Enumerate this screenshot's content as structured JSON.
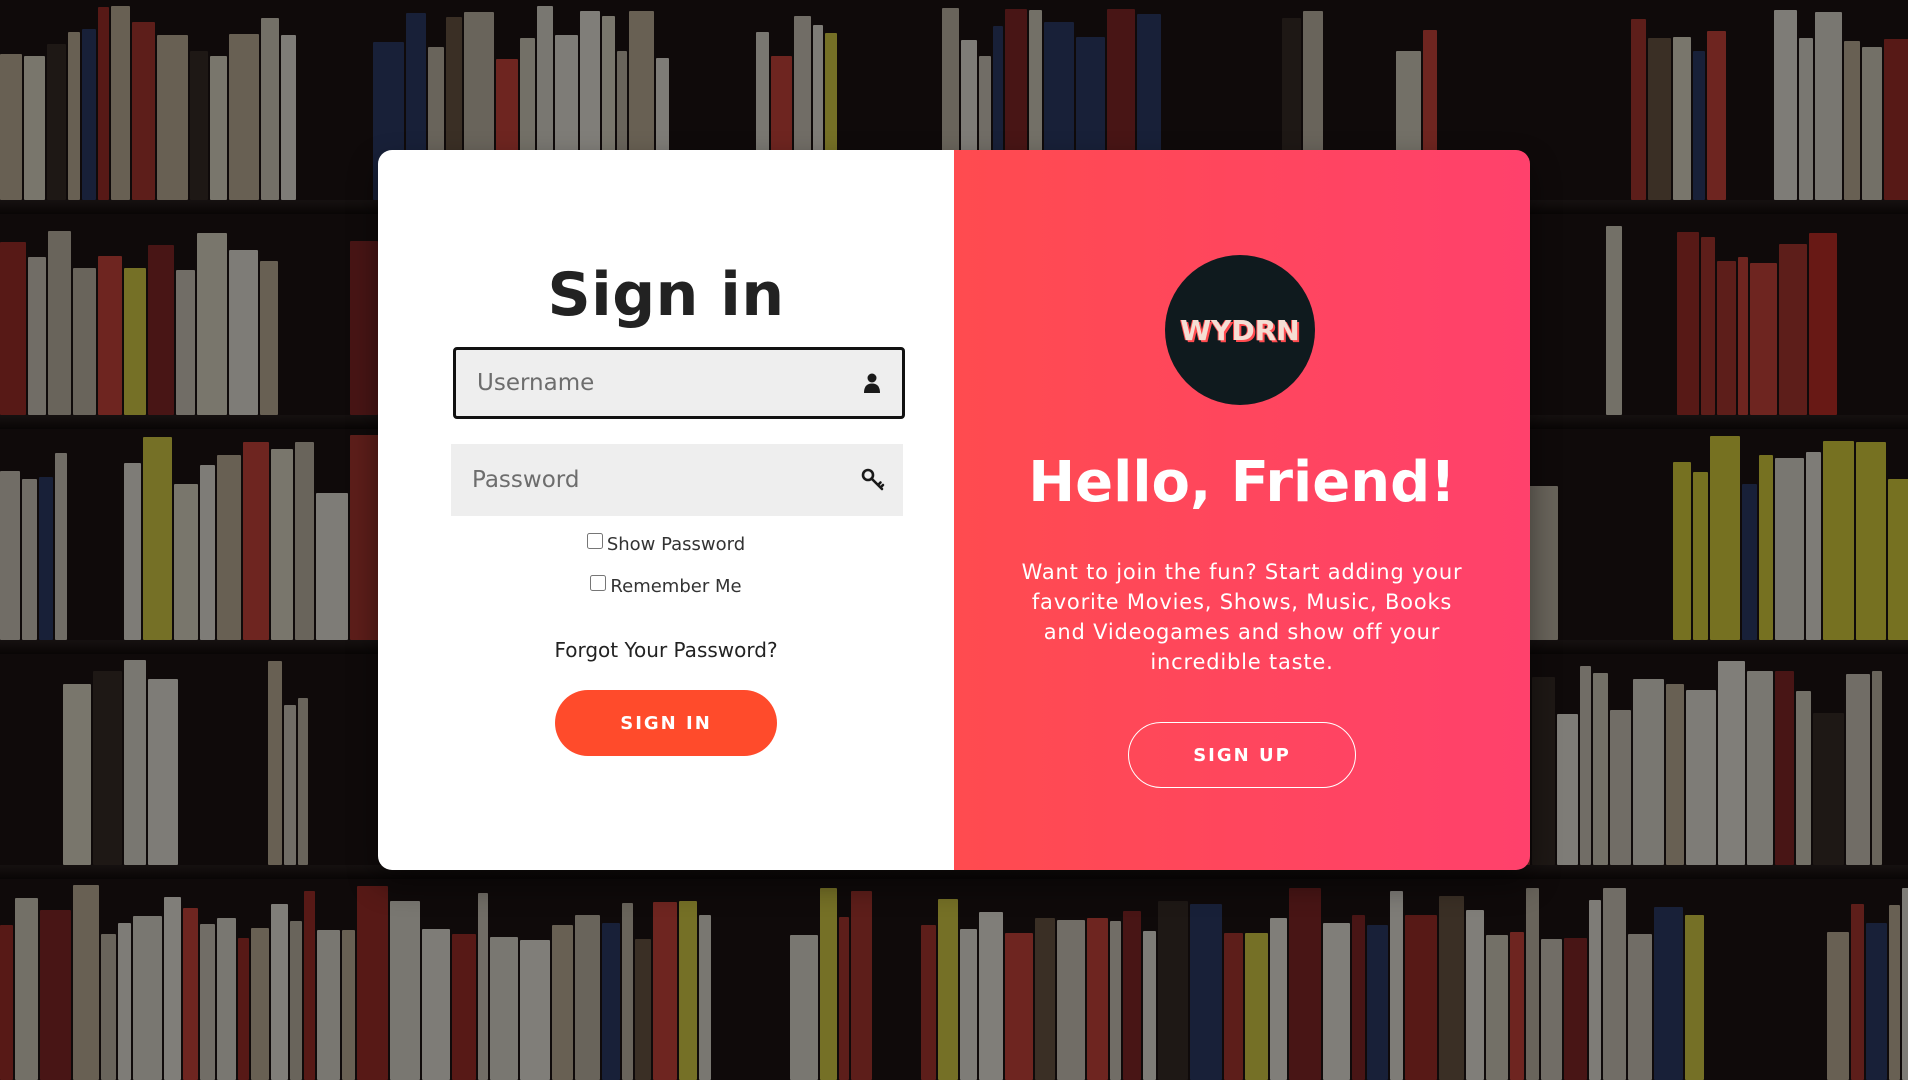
{
  "signin": {
    "title": "Sign in",
    "username_placeholder": "Username",
    "password_placeholder": "Password",
    "username_icon": "user-icon",
    "password_icon": "key-icon",
    "show_password_label": "Show Password",
    "remember_me_label": "Remember Me",
    "forgot_password": "Forgot Your Password?",
    "button_label": "SIGN IN"
  },
  "signup": {
    "logo_text": "WYDRN",
    "heading": "Hello, Friend!",
    "blurb": "Want to join the fun? Start adding your favorite Movies, Shows, Music, Books and Videogames and show off your incredible taste.",
    "button_label": "SIGN UP"
  },
  "colors": {
    "accent": "#ff4b2b",
    "panel_gradient_start": "#ff4b4f",
    "panel_gradient_end": "#ff416c",
    "logo_bg": "#0f1a1e",
    "input_bg": "#eeeeee"
  }
}
